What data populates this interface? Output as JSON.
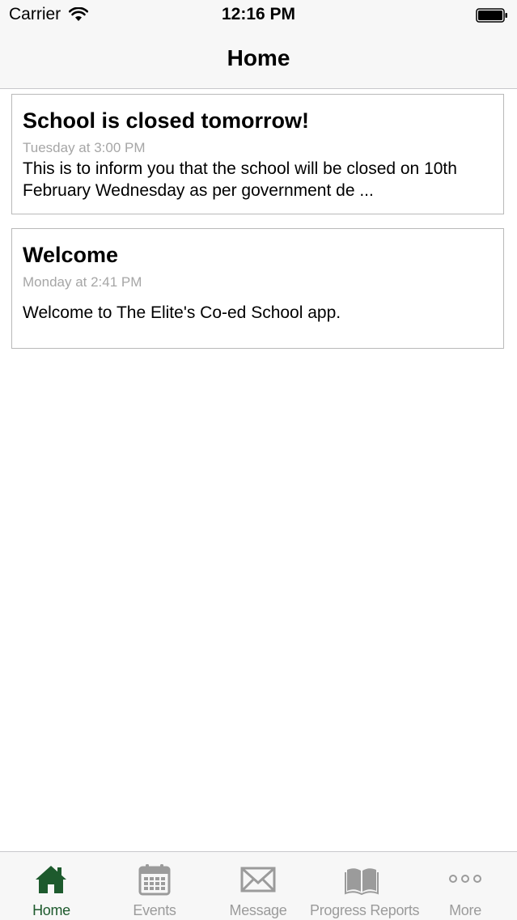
{
  "status_bar": {
    "carrier": "Carrier",
    "time": "12:16 PM"
  },
  "nav": {
    "title": "Home"
  },
  "posts": [
    {
      "title": "School is closed tomorrow!",
      "time": "Tuesday at 3:00 PM",
      "body": "This is to inform you that the school will be closed on 10th February Wednesday as per government de ..."
    },
    {
      "title": "Welcome",
      "time": "Monday at 2:41 PM",
      "body": "Welcome to The Elite's Co-ed School app."
    }
  ],
  "tabs": [
    {
      "label": "Home",
      "icon": "home-icon",
      "active": true
    },
    {
      "label": "Events",
      "icon": "calendar-icon",
      "active": false
    },
    {
      "label": "Message",
      "icon": "envelope-icon",
      "active": false
    },
    {
      "label": "Progress Reports",
      "icon": "book-icon",
      "active": false
    },
    {
      "label": "More",
      "icon": "more-dots-icon",
      "active": false
    }
  ],
  "colors": {
    "accent": "#1d5a2d",
    "inactive": "#9b9b9b",
    "timestamp": "#a6a6a6",
    "bar_background": "#f7f7f7"
  }
}
